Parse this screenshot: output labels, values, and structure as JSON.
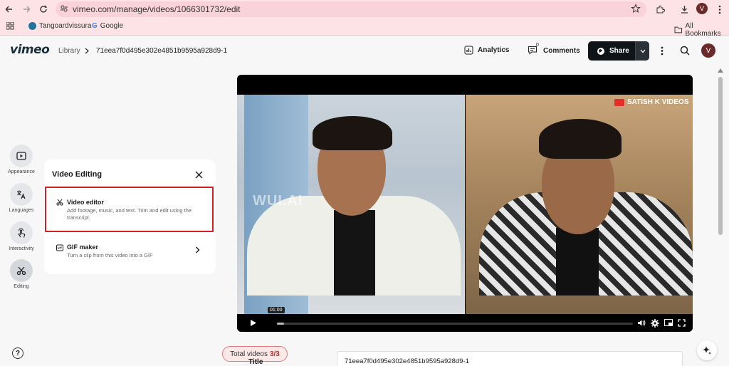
{
  "browser": {
    "url": "vimeo.com/manage/videos/1066301732/edit",
    "bookmarks": [
      "Tangoardvissura -",
      "Google"
    ],
    "all_bookmarks": "All Bookmarks",
    "profile_initial": "V"
  },
  "header": {
    "logo": "vimeo",
    "breadcrumb_root": "Library",
    "video_title": "71eea7f0d495e302e4851b9595a928d9-1",
    "analytics_label": "Analytics",
    "comments_label": "Comments",
    "comments_count": "0",
    "share_label": "Share",
    "user_initial": "V"
  },
  "rail": {
    "items": [
      {
        "label": "Appearance",
        "icon": "play-square-icon"
      },
      {
        "label": "Languages",
        "icon": "translate-icon"
      },
      {
        "label": "Interactivity",
        "icon": "tap-icon"
      },
      {
        "label": "Editing",
        "icon": "scissors-icon"
      }
    ]
  },
  "panel": {
    "title": "Video Editing",
    "options": [
      {
        "title": "Video editor",
        "desc": "Add footage, music, and text. Trim and edit using the transcript."
      },
      {
        "title": "GIF maker",
        "desc": "Turn a clip from this video into a GIF"
      }
    ]
  },
  "video": {
    "watermark": "SATISH K VIDEOS",
    "overlay": "WUI.AI",
    "time_tip": "01:00",
    "progress": 0.02
  },
  "bottom": {
    "total_label": "Total videos",
    "total_value": "3/3",
    "title_label": "Title",
    "title_value": "71eea7f0d495e302e4851b9595a928d9-1"
  }
}
